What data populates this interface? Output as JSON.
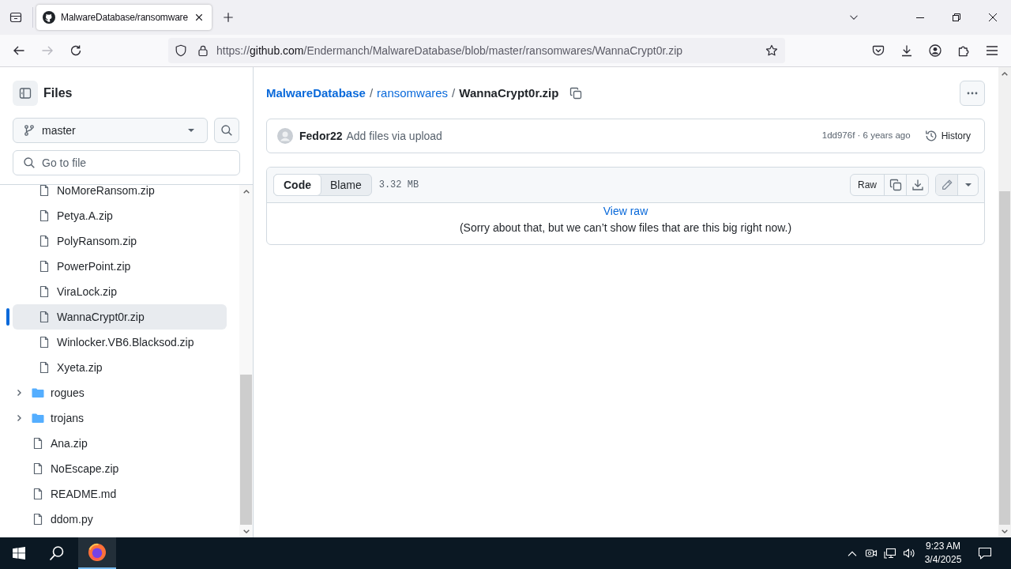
{
  "browser": {
    "tabs": [
      {
        "title": "MalwareDatabase/ransomware",
        "selected": true
      }
    ],
    "nav_buttons": [
      {
        "kind": "back",
        "disabled": false
      },
      {
        "kind": "forward",
        "disabled": true
      },
      {
        "kind": "reload",
        "disabled": false
      }
    ],
    "address": {
      "scheme": "https://",
      "host": "github.com",
      "path": "/Endermanch/MalwareDatabase/blob/master/ransomwares/WannaCrypt0r.zip"
    }
  },
  "sidebar": {
    "title": "Files",
    "branch": "master",
    "file_search": {
      "placeholder": "Go to file"
    },
    "tree": [
      {
        "children": [
          {
            "kind": "file",
            "name": "NoMoreRansom.zip",
            "selected": false
          },
          {
            "kind": "file",
            "name": "Petya.A.zip",
            "selected": false
          },
          {
            "kind": "file",
            "name": "PolyRansom.zip",
            "selected": false
          },
          {
            "kind": "file",
            "name": "PowerPoint.zip",
            "selected": false
          },
          {
            "kind": "file",
            "name": "ViraLock.zip",
            "selected": false
          },
          {
            "kind": "file",
            "name": "WannaCrypt0r.zip",
            "selected": true
          },
          {
            "kind": "file",
            "name": "Winlocker.VB6.Blacksod.zip",
            "selected": false
          },
          {
            "kind": "file",
            "name": "Xyeta.zip",
            "selected": false
          }
        ]
      },
      {
        "kind": "folder",
        "name": "rogues",
        "expanded": false,
        "selected": false
      },
      {
        "kind": "folder",
        "name": "trojans",
        "expanded": false,
        "selected": false
      },
      {
        "kind": "file",
        "name": "Ana.zip",
        "selected": false
      },
      {
        "kind": "file",
        "name": "NoEscape.zip",
        "selected": false
      },
      {
        "kind": "file",
        "name": "README.md",
        "selected": false
      },
      {
        "kind": "file",
        "name": "ddom.py",
        "selected": false
      }
    ]
  },
  "breadcrumb": [
    {
      "kind": "repo",
      "text": "MalwareDatabase"
    },
    {
      "kind": "separator",
      "text": "/"
    },
    {
      "kind": "folder",
      "text": "ransomwares"
    },
    {
      "kind": "separator",
      "text": "/"
    },
    {
      "kind": "file",
      "text": "WannaCrypt0r.zip"
    }
  ],
  "commit": {
    "author": "Fedor22",
    "message": "Add files via upload",
    "meta": "1dd976f · 6 years ago",
    "history": "History"
  },
  "file": {
    "view_tabs": [
      {
        "label": "Code",
        "selected": true
      },
      {
        "label": "Blame",
        "selected": false
      }
    ],
    "size": "3.32 MB",
    "raw_button": "Raw",
    "body_link": "View raw",
    "body_message": "(Sorry about that, but we can’t show files that are this big right now.)"
  },
  "taskbar": {
    "apps": [
      {
        "kind": "firefox",
        "active": true
      }
    ],
    "clock": {
      "time": "9:23 AM",
      "date": "3/4/2025"
    }
  }
}
